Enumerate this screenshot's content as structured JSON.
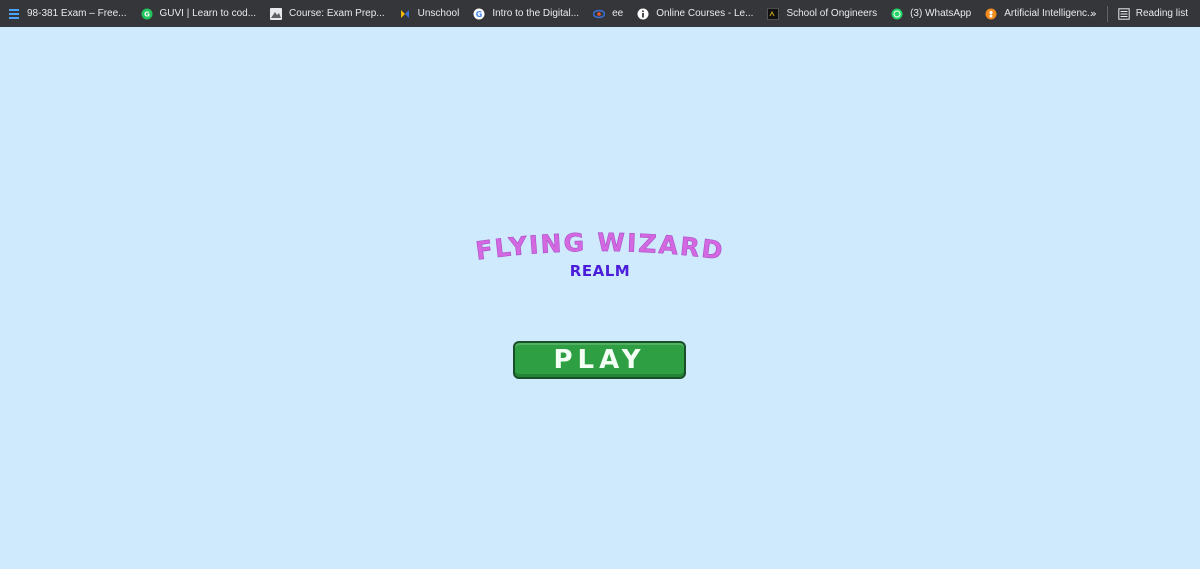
{
  "bookmarks": [
    {
      "label": "98-381 Exam – Free...",
      "icon": "bars-icon",
      "color": "#4aa3ff"
    },
    {
      "label": "GUVI | Learn to cod...",
      "icon": "guvi-icon",
      "color": "#21c45d"
    },
    {
      "label": "Course: Exam Prep...",
      "icon": "mountain-icon",
      "color": "#9aa0a6"
    },
    {
      "label": "Unschool",
      "icon": "unschool-icon",
      "color": "#f2b705"
    },
    {
      "label": "Intro to the Digital...",
      "icon": "google-icon",
      "color": "#4285f4"
    },
    {
      "label": "ee",
      "icon": "ee-icon",
      "color": "#3b6fd8"
    },
    {
      "label": "Online Courses - Le...",
      "icon": "info-icon",
      "color": "#ffffff"
    },
    {
      "label": "School of Ongineers",
      "icon": "sog-icon",
      "color": "#c9a227"
    },
    {
      "label": "(3) WhatsApp",
      "icon": "whatsapp-icon",
      "color": "#25d366"
    },
    {
      "label": "Artificial Intelligenc...",
      "icon": "ai-icon",
      "color": "#f28b1e"
    }
  ],
  "bookmarks_overflow": "»",
  "reading_list": {
    "label": "Reading list",
    "icon": "reading-list-icon"
  },
  "game": {
    "title": "FLYING WIZARD",
    "subtitle": "REALM",
    "play_label": "PLAY",
    "background": "#cfeafc",
    "title_color": "#d468e0",
    "subtitle_color": "#4b1cd9",
    "button_color": "#2ea043"
  }
}
